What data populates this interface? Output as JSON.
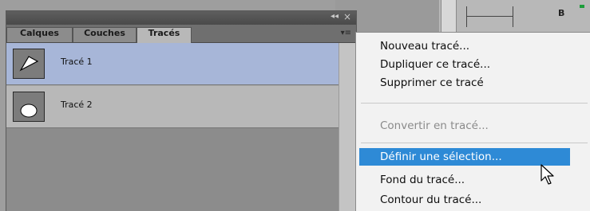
{
  "panel": {
    "tabs": [
      "Calques",
      "Couches",
      "Tracés"
    ],
    "active_tab": "Tracés",
    "rows": [
      {
        "label": "Tracé 1",
        "selected": true,
        "thumb_icon": "triangle-path-icon"
      },
      {
        "label": "Tracé 2",
        "selected": false,
        "thumb_icon": "circle-path-icon"
      }
    ],
    "titlebar_icons": [
      "collapse-icon",
      "close-icon"
    ],
    "selection_color": "#a7b6d8"
  },
  "background": {
    "label_b": "B"
  },
  "menu": {
    "items": [
      {
        "label": "Nouveau tracé...",
        "state": "normal"
      },
      {
        "label": "Dupliquer ce tracé...",
        "state": "normal"
      },
      {
        "label": "Supprimer ce tracé",
        "state": "normal"
      },
      {
        "label": "Convertir en tracé...",
        "state": "disabled"
      },
      {
        "label": "Définir une sélection...",
        "state": "hover"
      },
      {
        "label": "Fond du tracé...",
        "state": "normal"
      },
      {
        "label": "Contour du tracé...",
        "state": "normal"
      }
    ],
    "highlight_color": "#2e8ad6"
  }
}
